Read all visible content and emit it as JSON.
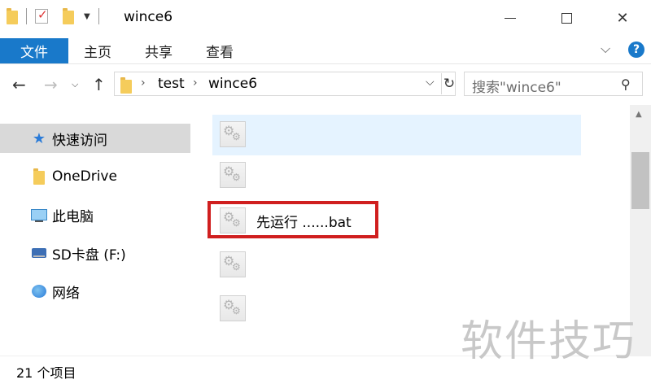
{
  "window": {
    "title": "wince6",
    "minimize_glyph": "",
    "maximize_glyph": "",
    "close_glyph": "✕"
  },
  "ribbon": {
    "tabs": [
      "文件",
      "主页",
      "共享",
      "查看"
    ],
    "collapse_glyph": "⌵",
    "help_glyph": "?"
  },
  "address": {
    "path": [
      "test",
      "wince6"
    ],
    "separator": "›",
    "dropdown_glyph": "⌵",
    "refresh_glyph": "↻"
  },
  "search": {
    "placeholder": "搜索\"wince6\"",
    "icon_glyph": "⚲"
  },
  "nav_buttons": {
    "back": "←",
    "forward": "→",
    "recent": "⌵",
    "up": "↑"
  },
  "sidebar": {
    "items": [
      {
        "label": "快速访问",
        "icon": "star-icon",
        "selected": true
      },
      {
        "label": "OneDrive",
        "icon": "folder-icon",
        "selected": false
      },
      {
        "label": "此电脑",
        "icon": "computer-icon",
        "selected": false
      },
      {
        "label": "SD卡盘 (F:)",
        "icon": "drive-icon",
        "selected": false
      },
      {
        "label": "网络",
        "icon": "network-icon",
        "selected": false
      }
    ]
  },
  "files": [
    {
      "label": "",
      "icon": "batch-file-icon",
      "hovered": true
    },
    {
      "label": "",
      "icon": "batch-file-icon",
      "hovered": false
    },
    {
      "label": "先运行 ......bat",
      "icon": "batch-file-icon",
      "hovered": false,
      "highlighted": true
    },
    {
      "label": "",
      "icon": "batch-file-icon",
      "hovered": false
    },
    {
      "label": "",
      "icon": "batch-file-icon",
      "hovered": false
    }
  ],
  "status": {
    "item_count": "21 个项目"
  },
  "watermark": "软件技巧",
  "colors": {
    "accent": "#1979ca",
    "highlight_border": "#d01f1f",
    "hover_row": "#e5f3ff",
    "selected_nav": "#d9d9d9"
  }
}
